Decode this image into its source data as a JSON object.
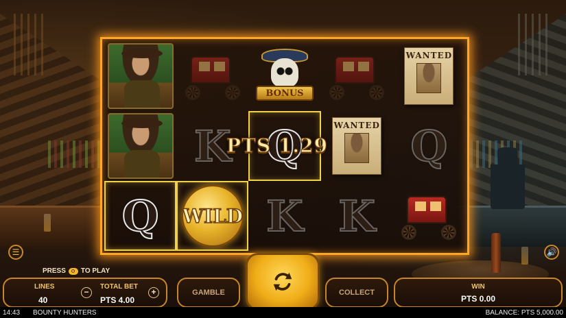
{
  "reels": {
    "symbols": [
      [
        "hunter",
        "coach",
        "bonus",
        "coach",
        "wanted"
      ],
      [
        "hunter",
        "K",
        "Q",
        "wanted",
        "Q"
      ],
      [
        "Q",
        "wild",
        "K",
        "K",
        "coach"
      ]
    ],
    "bonus_label": "BONUS",
    "wild_label": "WILD",
    "wanted_label": "WANTED",
    "win_amount_text": "PTS 1.29"
  },
  "controls": {
    "press_prefix": "PRESS",
    "press_suffix": "TO PLAY",
    "lines_label": "LINES",
    "lines_value": "40",
    "total_bet_label": "TOTAL BET",
    "total_bet_value": "PTS 4.00",
    "minus_label": "−",
    "plus_label": "+",
    "gamble_label": "GAMBLE",
    "collect_label": "COLLECT",
    "win_label": "WIN",
    "win_value": "PTS 0.00"
  },
  "status": {
    "time": "14:43",
    "game_title": "BOUNTY HUNTERS",
    "balance": "BALANCE: PTS 5,000.00"
  },
  "icons": {
    "menu": "menu-icon",
    "sound": "sound-icon",
    "spin": "spin-icon",
    "press_key": "key-icon"
  },
  "colors": {
    "frame": "#ffa826",
    "accent": "#f0ad18",
    "panel_border": "#c8862a"
  }
}
